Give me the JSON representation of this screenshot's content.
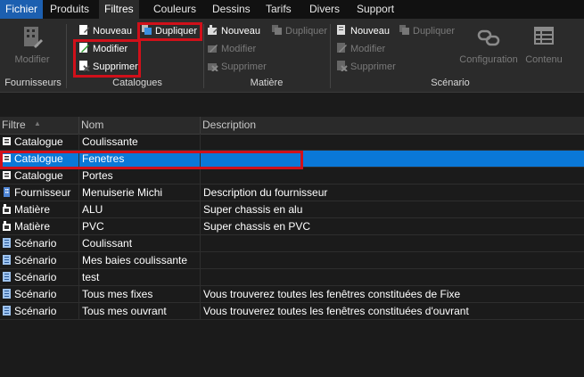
{
  "menu": [
    "Fichier",
    "Produits",
    "Filtres",
    "Couleurs",
    "Dessins",
    "Tarifs",
    "Divers",
    "Support"
  ],
  "ribbon": {
    "fournisseurs": {
      "modifier": "Modifier",
      "label": "Fournisseurs"
    },
    "catalogues": {
      "nouveau": "Nouveau",
      "dupliquer": "Dupliquer",
      "modifier": "Modifier",
      "supprimer": "Supprimer",
      "label": "Catalogues"
    },
    "matiere": {
      "nouveau": "Nouveau",
      "dupliquer": "Dupliquer",
      "modifier": "Modifier",
      "supprimer": "Supprimer",
      "label": "Matière"
    },
    "scenario": {
      "nouveau": "Nouveau",
      "dupliquer": "Dupliquer",
      "modifier": "Modifier",
      "supprimer": "Supprimer",
      "configuration": "Configuration",
      "contenu": "Contenu",
      "label": "Scénario"
    }
  },
  "table": {
    "columns": [
      "Filtre",
      "Nom",
      "Description"
    ],
    "rows": [
      {
        "filtre": "Catalogue",
        "nom": "Coulissante",
        "description": "",
        "icon": "catalogue-icon"
      },
      {
        "filtre": "Catalogue",
        "nom": "Fenetres",
        "description": "",
        "icon": "catalogue-icon"
      },
      {
        "filtre": "Catalogue",
        "nom": "Portes",
        "description": "",
        "icon": "catalogue-icon"
      },
      {
        "filtre": "Fournisseur",
        "nom": "Menuiserie Michi",
        "description": "Description du fournisseur",
        "icon": "fournisseur-icon"
      },
      {
        "filtre": "Matière",
        "nom": "ALU",
        "description": "Super chassis en alu",
        "icon": "matiere-icon"
      },
      {
        "filtre": "Matière",
        "nom": "PVC",
        "description": "Super chassis en PVC",
        "icon": "matiere-icon"
      },
      {
        "filtre": "Scénario",
        "nom": "Coulissant",
        "description": "",
        "icon": "scenario-icon"
      },
      {
        "filtre": "Scénario",
        "nom": "Mes baies coulissante",
        "description": "",
        "icon": "scenario-icon"
      },
      {
        "filtre": "Scénario",
        "nom": "test",
        "description": "",
        "icon": "scenario-icon"
      },
      {
        "filtre": "Scénario",
        "nom": "Tous mes fixes",
        "description": "Vous trouverez toutes les fenêtres constituées de Fixe",
        "icon": "scenario-icon"
      },
      {
        "filtre": "Scénario",
        "nom": "Tous mes ouvrant",
        "description": "Vous trouverez toutes les fenêtres constituées d'ouvrant",
        "icon": "scenario-icon"
      }
    ]
  },
  "selected_row": 1,
  "colors": {
    "selection": "#0a78d7",
    "highlight": "#d0101a",
    "background": "#1b1b1b",
    "ribbon": "#2b2b2b",
    "file_tab": "#1c5fb0"
  }
}
